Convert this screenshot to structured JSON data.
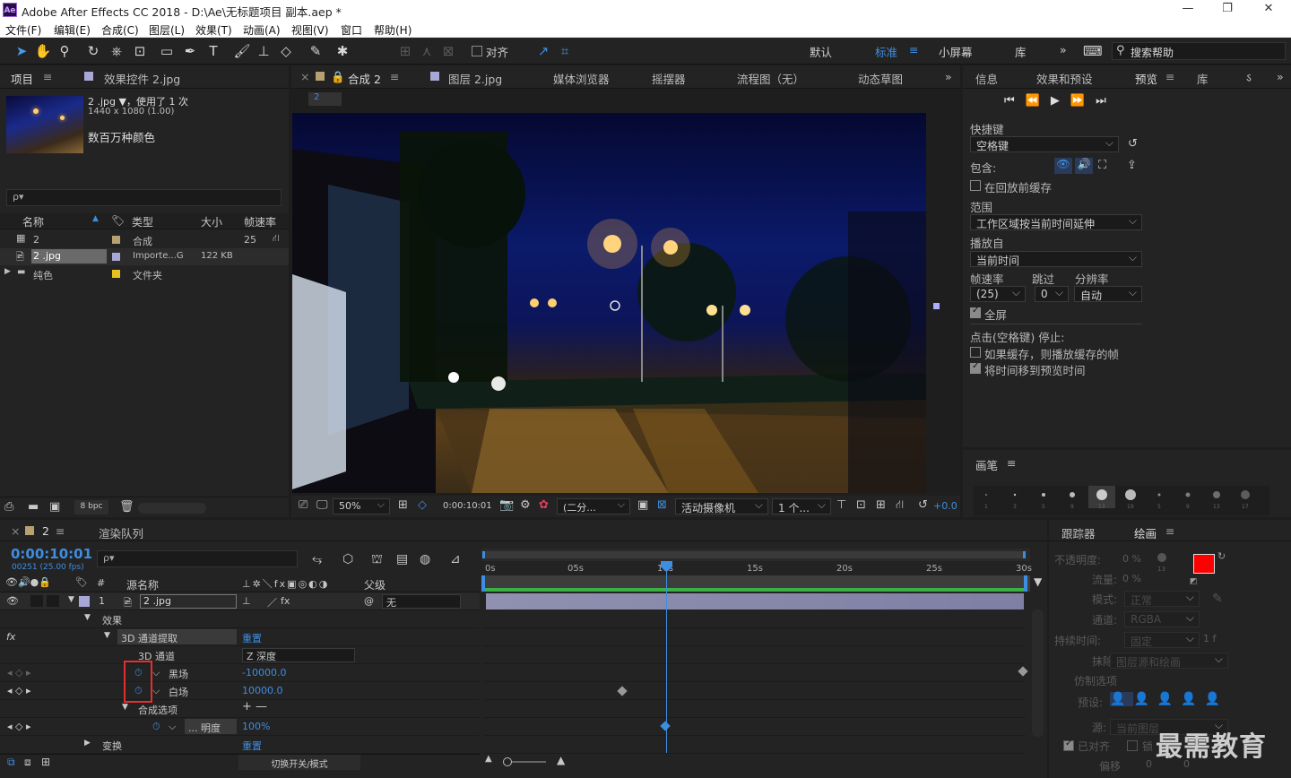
{
  "app": {
    "title": "Adobe After Effects CC 2018 - D:\\Ae\\无标题项目 副本.aep *",
    "logo": "Ae"
  },
  "window": {
    "min": "—",
    "max": "❐",
    "close": "✕"
  },
  "menu": [
    "文件(F)",
    "编辑(E)",
    "合成(C)",
    "图层(L)",
    "效果(T)",
    "动画(A)",
    "视图(V)",
    "窗口",
    "帮助(H)"
  ],
  "toolbar": {
    "align_label": "对齐",
    "workspaces": [
      "默认",
      "标准",
      "小屏幕",
      "库"
    ],
    "active_workspace": "标准",
    "search_placeholder": "搜索帮助",
    "more": "»"
  },
  "project": {
    "tab": "项目",
    "effects_tab": "效果控件 2.jpg",
    "file_name": "2 .jpg ▼，使用了 1 次",
    "file_dims": "1440 x 1080 (1.00)",
    "file_colors": "数百万种颜色",
    "search_placeholder": "ρ▾",
    "columns": [
      "名称",
      "类型",
      "大小",
      "帧速率"
    ],
    "rows": [
      {
        "name": "2",
        "type": "合成",
        "size": "",
        "fps": "25",
        "color": "#b8a070"
      },
      {
        "name": "2 .jpg",
        "type": "Importe...G",
        "size": "122 KB",
        "fps": "",
        "color": "#a8a8d8"
      },
      {
        "name": "纯色",
        "type": "文件夹",
        "size": "",
        "fps": "",
        "color": "#e6c020"
      }
    ],
    "bpc": "8 bpc"
  },
  "viewer": {
    "tabs": [
      "合成 2",
      "图层 2.jpg",
      "媒体浏览器",
      "摇摆器",
      "流程图（无）",
      "动态草图"
    ],
    "comp_chip": "2",
    "zoom": "50%",
    "timecode": "0:00:10:01",
    "resolution": "(二分...",
    "camera": "活动摄像机",
    "views": "1 个...",
    "exposure": "+0.0"
  },
  "preview": {
    "tabs": [
      "信息",
      "效果和预设",
      "预览",
      "库",
      "ऽ"
    ],
    "shortcut_label": "快捷键",
    "shortcut_value": "空格键",
    "include_label": "包含:",
    "cache_before": "在回放前缓存",
    "range_label": "范围",
    "range_value": "工作区域按当前时间延伸",
    "play_from_label": "播放自",
    "play_from_value": "当前时间",
    "fps_label": "帧速率",
    "skip_label": "跳过",
    "res_label": "分辨率",
    "fps_value": "(25)",
    "skip_value": "0",
    "res_value": "自动",
    "fullscreen": "全屏",
    "stop_label": "点击(空格键) 停止:",
    "if_cached": "如果缓存，则播放缓存的帧",
    "move_time": "将时间移到预览时间",
    "brush_tab": "画笔",
    "brush_sizes": [
      "1",
      "3",
      "5",
      "9",
      "13",
      "19",
      "5",
      "9",
      "13",
      "17"
    ]
  },
  "timeline": {
    "comp_tab": "2",
    "render_tab": "渲染队列",
    "timecode": "0:00:10:01",
    "fps_info": "00251 (25.00 fps)",
    "search_placeholder": "ρ▾",
    "col_headers": {
      "num": "#",
      "source": "源名称",
      "parent": "父级"
    },
    "layer": {
      "index": "1",
      "name": "2 .jpg",
      "parent": "无"
    },
    "rows": {
      "effects": "效果",
      "effect_name": "3D 通道提取",
      "reset": "重置",
      "channel_label": "3D 通道",
      "channel_value": "Z 深度",
      "black_label": "黑场",
      "black_value": "-10000.0",
      "white_label": "白场",
      "white_value": "10000.0",
      "comp_opts": "合成选项",
      "plus_minus": "+ —",
      "opacity_label": "... 明度",
      "opacity_value": "100%",
      "transform": "变换"
    },
    "ruler": [
      "0s",
      "05s",
      "10s",
      "15s",
      "20s",
      "25s",
      "30s"
    ],
    "toggle_label": "切换开关/模式"
  },
  "paint": {
    "tracker_tab": "跟踪器",
    "paint_tab": "绘画",
    "opacity_label": "不透明度:",
    "opacity_value": "0 %",
    "flow_label": "流量:",
    "flow_value": "0 %",
    "mode_label": "模式:",
    "mode_value": "正常",
    "channel_label": "通道:",
    "channel_value": "RGBA",
    "duration_label": "持续时间:",
    "duration_value": "固定",
    "duration_frames": "1 f",
    "erase_label": "抹除:",
    "erase_value": "图层源和绘画",
    "clone_label": "仿制选项",
    "preset_label": "预设:",
    "source_label": "源:",
    "source_value": "当前图层",
    "aligned": "已对齐",
    "locked": "锁",
    "offset": "偏移",
    "offset_x": "0",
    "offset_y": "0",
    "brush_num": "13",
    "fg": "#ff0000",
    "bg": "#ffffff"
  },
  "watermark": "最需教育"
}
